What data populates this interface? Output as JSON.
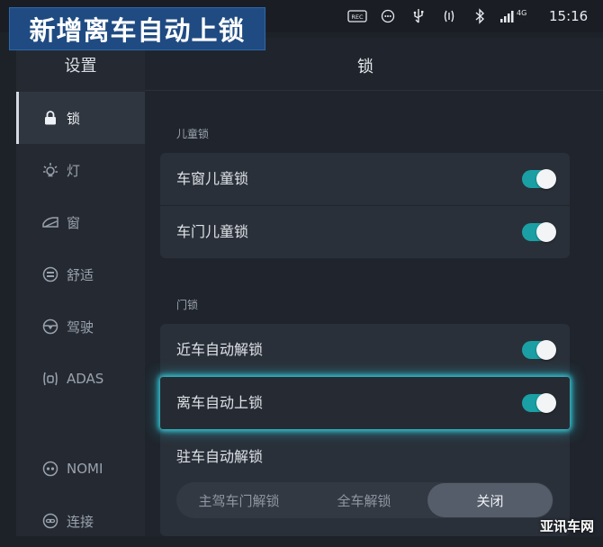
{
  "banner": {
    "text": "新增离车自动上锁"
  },
  "statusbar": {
    "rec_label": "REC",
    "network_label": "4G",
    "time": "15:16",
    "icons": [
      "rec-icon",
      "chat-icon",
      "usb-icon",
      "nfc-icon",
      "bluetooth-icon",
      "signal-icon"
    ]
  },
  "sidebar": {
    "title": "设置",
    "items": [
      {
        "label": "锁",
        "icon": "lock-icon",
        "active": true
      },
      {
        "label": "灯",
        "icon": "light-icon",
        "active": false
      },
      {
        "label": "窗",
        "icon": "window-icon",
        "active": false
      },
      {
        "label": "舒适",
        "icon": "comfort-icon",
        "active": false
      },
      {
        "label": "驾驶",
        "icon": "steering-wheel-icon",
        "active": false
      },
      {
        "label": "ADAS",
        "icon": "adas-icon",
        "active": false
      },
      {
        "label": "NOMI",
        "icon": "nomi-icon",
        "active": false
      },
      {
        "label": "连接",
        "icon": "link-icon",
        "active": false
      }
    ]
  },
  "main": {
    "title": "锁",
    "sections": [
      {
        "label": "儿童锁",
        "rows": [
          {
            "label": "车窗儿童锁",
            "on": true
          },
          {
            "label": "车门儿童锁",
            "on": true
          }
        ]
      },
      {
        "label": "门锁",
        "rows": [
          {
            "label": "近车自动解锁",
            "on": true
          },
          {
            "label": "离车自动上锁",
            "on": true,
            "highlighted": true
          }
        ]
      }
    ],
    "parking_unlock": {
      "label": "驻车自动解锁",
      "options": [
        "主驾车门解锁",
        "全车解锁",
        "关闭"
      ],
      "selected": "关闭"
    }
  },
  "watermark": "亚讯车网",
  "colors": {
    "accent": "#1aa0a4",
    "highlight_glow": "#3cdceb",
    "banner": "#1f4b82"
  }
}
